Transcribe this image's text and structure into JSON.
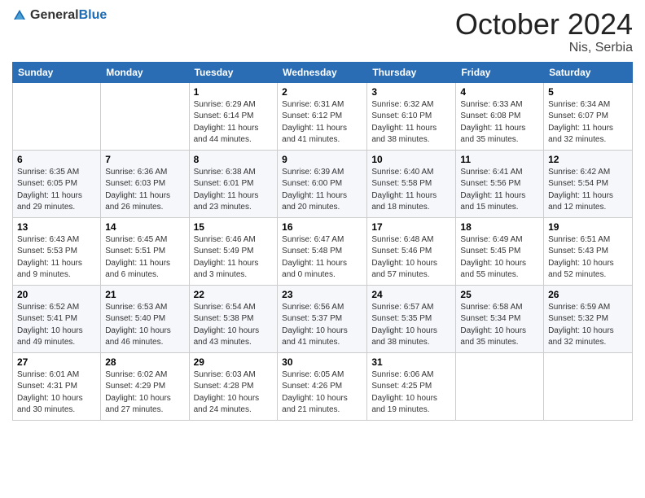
{
  "logo": {
    "general": "General",
    "blue": "Blue"
  },
  "header": {
    "month": "October 2024",
    "location": "Nis, Serbia"
  },
  "weekdays": [
    "Sunday",
    "Monday",
    "Tuesday",
    "Wednesday",
    "Thursday",
    "Friday",
    "Saturday"
  ],
  "weeks": [
    [
      {
        "day": "",
        "info": ""
      },
      {
        "day": "",
        "info": ""
      },
      {
        "day": "1",
        "info": "Sunrise: 6:29 AM\nSunset: 6:14 PM\nDaylight: 11 hours and 44 minutes."
      },
      {
        "day": "2",
        "info": "Sunrise: 6:31 AM\nSunset: 6:12 PM\nDaylight: 11 hours and 41 minutes."
      },
      {
        "day": "3",
        "info": "Sunrise: 6:32 AM\nSunset: 6:10 PM\nDaylight: 11 hours and 38 minutes."
      },
      {
        "day": "4",
        "info": "Sunrise: 6:33 AM\nSunset: 6:08 PM\nDaylight: 11 hours and 35 minutes."
      },
      {
        "day": "5",
        "info": "Sunrise: 6:34 AM\nSunset: 6:07 PM\nDaylight: 11 hours and 32 minutes."
      }
    ],
    [
      {
        "day": "6",
        "info": "Sunrise: 6:35 AM\nSunset: 6:05 PM\nDaylight: 11 hours and 29 minutes."
      },
      {
        "day": "7",
        "info": "Sunrise: 6:36 AM\nSunset: 6:03 PM\nDaylight: 11 hours and 26 minutes."
      },
      {
        "day": "8",
        "info": "Sunrise: 6:38 AM\nSunset: 6:01 PM\nDaylight: 11 hours and 23 minutes."
      },
      {
        "day": "9",
        "info": "Sunrise: 6:39 AM\nSunset: 6:00 PM\nDaylight: 11 hours and 20 minutes."
      },
      {
        "day": "10",
        "info": "Sunrise: 6:40 AM\nSunset: 5:58 PM\nDaylight: 11 hours and 18 minutes."
      },
      {
        "day": "11",
        "info": "Sunrise: 6:41 AM\nSunset: 5:56 PM\nDaylight: 11 hours and 15 minutes."
      },
      {
        "day": "12",
        "info": "Sunrise: 6:42 AM\nSunset: 5:54 PM\nDaylight: 11 hours and 12 minutes."
      }
    ],
    [
      {
        "day": "13",
        "info": "Sunrise: 6:43 AM\nSunset: 5:53 PM\nDaylight: 11 hours and 9 minutes."
      },
      {
        "day": "14",
        "info": "Sunrise: 6:45 AM\nSunset: 5:51 PM\nDaylight: 11 hours and 6 minutes."
      },
      {
        "day": "15",
        "info": "Sunrise: 6:46 AM\nSunset: 5:49 PM\nDaylight: 11 hours and 3 minutes."
      },
      {
        "day": "16",
        "info": "Sunrise: 6:47 AM\nSunset: 5:48 PM\nDaylight: 11 hours and 0 minutes."
      },
      {
        "day": "17",
        "info": "Sunrise: 6:48 AM\nSunset: 5:46 PM\nDaylight: 10 hours and 57 minutes."
      },
      {
        "day": "18",
        "info": "Sunrise: 6:49 AM\nSunset: 5:45 PM\nDaylight: 10 hours and 55 minutes."
      },
      {
        "day": "19",
        "info": "Sunrise: 6:51 AM\nSunset: 5:43 PM\nDaylight: 10 hours and 52 minutes."
      }
    ],
    [
      {
        "day": "20",
        "info": "Sunrise: 6:52 AM\nSunset: 5:41 PM\nDaylight: 10 hours and 49 minutes."
      },
      {
        "day": "21",
        "info": "Sunrise: 6:53 AM\nSunset: 5:40 PM\nDaylight: 10 hours and 46 minutes."
      },
      {
        "day": "22",
        "info": "Sunrise: 6:54 AM\nSunset: 5:38 PM\nDaylight: 10 hours and 43 minutes."
      },
      {
        "day": "23",
        "info": "Sunrise: 6:56 AM\nSunset: 5:37 PM\nDaylight: 10 hours and 41 minutes."
      },
      {
        "day": "24",
        "info": "Sunrise: 6:57 AM\nSunset: 5:35 PM\nDaylight: 10 hours and 38 minutes."
      },
      {
        "day": "25",
        "info": "Sunrise: 6:58 AM\nSunset: 5:34 PM\nDaylight: 10 hours and 35 minutes."
      },
      {
        "day": "26",
        "info": "Sunrise: 6:59 AM\nSunset: 5:32 PM\nDaylight: 10 hours and 32 minutes."
      }
    ],
    [
      {
        "day": "27",
        "info": "Sunrise: 6:01 AM\nSunset: 4:31 PM\nDaylight: 10 hours and 30 minutes."
      },
      {
        "day": "28",
        "info": "Sunrise: 6:02 AM\nSunset: 4:29 PM\nDaylight: 10 hours and 27 minutes."
      },
      {
        "day": "29",
        "info": "Sunrise: 6:03 AM\nSunset: 4:28 PM\nDaylight: 10 hours and 24 minutes."
      },
      {
        "day": "30",
        "info": "Sunrise: 6:05 AM\nSunset: 4:26 PM\nDaylight: 10 hours and 21 minutes."
      },
      {
        "day": "31",
        "info": "Sunrise: 6:06 AM\nSunset: 4:25 PM\nDaylight: 10 hours and 19 minutes."
      },
      {
        "day": "",
        "info": ""
      },
      {
        "day": "",
        "info": ""
      }
    ]
  ]
}
